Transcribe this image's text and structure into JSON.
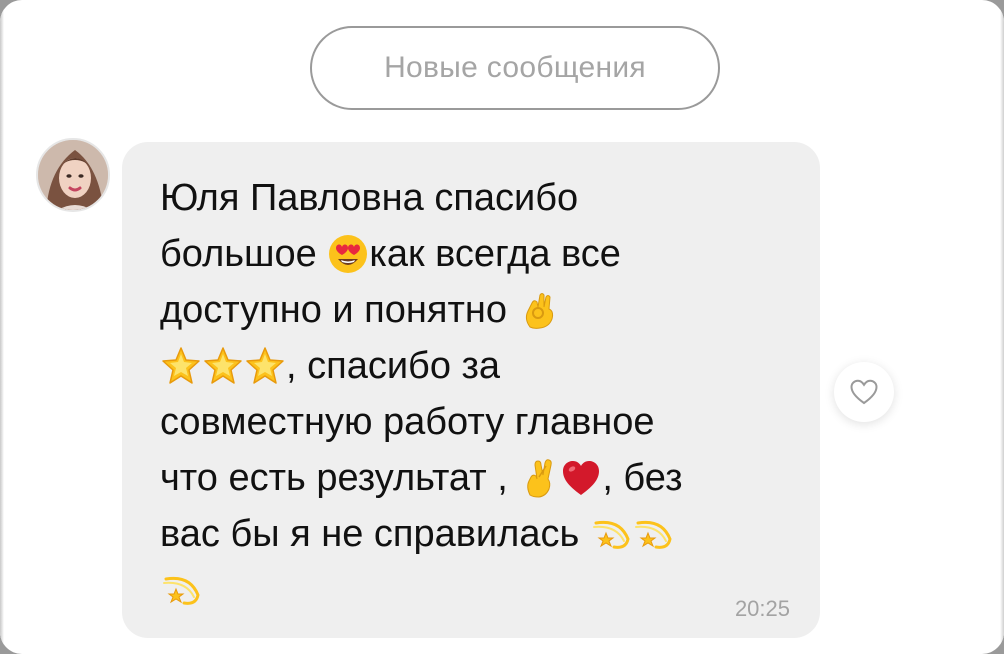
{
  "header": {
    "new_messages_label": "Новые сообщения"
  },
  "message": {
    "sender_avatar_icon": "avatar-photo",
    "lines": [
      {
        "before": "Юля Павловна спасибо",
        "emojis": [],
        "after": ""
      },
      {
        "before": "большое ",
        "emojis": [
          "heart-eyes-emoji"
        ],
        "after": "как всегда все"
      },
      {
        "before": "доступно и понятно ",
        "emojis": [
          "ok-hand-emoji"
        ],
        "after": ""
      },
      {
        "before": "",
        "emojis": [
          "star-emoji",
          "star-emoji",
          "star-emoji"
        ],
        "after": ", спасибо за"
      },
      {
        "before": "совместную работу главное",
        "emojis": [],
        "after": ""
      },
      {
        "before": "что есть результат , ",
        "emojis": [
          "crossed-fingers-emoji",
          "red-heart-emoji"
        ],
        "after": ", без"
      },
      {
        "before": "вас бы я не справилась ",
        "emojis": [
          "dizzy-emoji",
          "dizzy-emoji"
        ],
        "after": ""
      },
      {
        "before": "",
        "emojis": [
          "dizzy-emoji"
        ],
        "after": ""
      }
    ],
    "time": "20:25"
  },
  "actions": {
    "like_icon": "heart-outline-icon"
  },
  "colors": {
    "bubble_bg": "#efefef",
    "text": "#111111",
    "muted": "#a3a3a3"
  }
}
